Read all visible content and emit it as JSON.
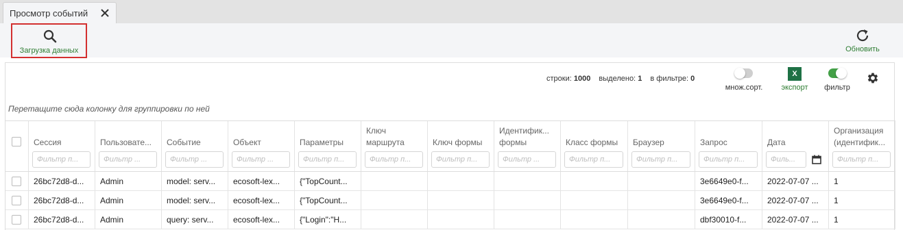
{
  "tab": {
    "title": "Просмотр событий"
  },
  "toolbar": {
    "load_label": "Загрузка данных",
    "refresh_label": "Обновить",
    "accent_color": "#2e7d32",
    "highlight_color": "#d32f2f"
  },
  "stats": {
    "rows_label": "строки:",
    "rows_value": "1000",
    "selected_label": "выделено:",
    "selected_value": "1",
    "filtered_label": "в фильтре:",
    "filtered_value": "0"
  },
  "controls": {
    "multisort_label": "множ.сорт.",
    "multisort_on": false,
    "export_label": "экспорт",
    "export_icon_text": "X",
    "filter_label": "фильтр",
    "filter_on": true,
    "settings_icon": "gear-icon"
  },
  "group_hint": "Перетащите сюда колонку для группировки по ней",
  "columns": [
    {
      "label": "Сессия",
      "placeholder": "Фильтр п..."
    },
    {
      "label": "Пользовате...",
      "placeholder": "Фильтр ..."
    },
    {
      "label": "Событие",
      "placeholder": "Фильтр ..."
    },
    {
      "label": "Объект",
      "placeholder": "Фильтр ..."
    },
    {
      "label": "Параметры",
      "placeholder": "Фильтр п..."
    },
    {
      "label": "Ключ маршрута",
      "placeholder": "Фильтр п..."
    },
    {
      "label": "Ключ формы",
      "placeholder": "Фильтр п..."
    },
    {
      "label": "Идентифик... формы",
      "placeholder": "Фильтр ..."
    },
    {
      "label": "Класс формы",
      "placeholder": "Фильтр п..."
    },
    {
      "label": "Браузер",
      "placeholder": "Фильтр п..."
    },
    {
      "label": "Запрос",
      "placeholder": "Фильтр п..."
    },
    {
      "label": "Дата",
      "placeholder": "Филь..."
    },
    {
      "label": "Организация (идентифик...",
      "placeholder": "Фильтр п..."
    }
  ],
  "rows": [
    [
      "26bc72d8-d...",
      "Admin",
      "model: serv...",
      "ecosoft-lex...",
      "{\"TopCount...",
      "",
      "",
      "",
      "",
      "",
      "3e6649e0-f...",
      "2022-07-07 ...",
      "1"
    ],
    [
      "26bc72d8-d...",
      "Admin",
      "model: serv...",
      "ecosoft-lex...",
      "{\"TopCount...",
      "",
      "",
      "",
      "",
      "",
      "3e6649e0-f...",
      "2022-07-07 ...",
      "1"
    ],
    [
      "26bc72d8-d...",
      "Admin",
      "query: serv...",
      "ecosoft-lex...",
      "{\"Login\":\"H...",
      "",
      "",
      "",
      "",
      "",
      "dbf30010-f...",
      "2022-07-07 ...",
      "1"
    ]
  ]
}
